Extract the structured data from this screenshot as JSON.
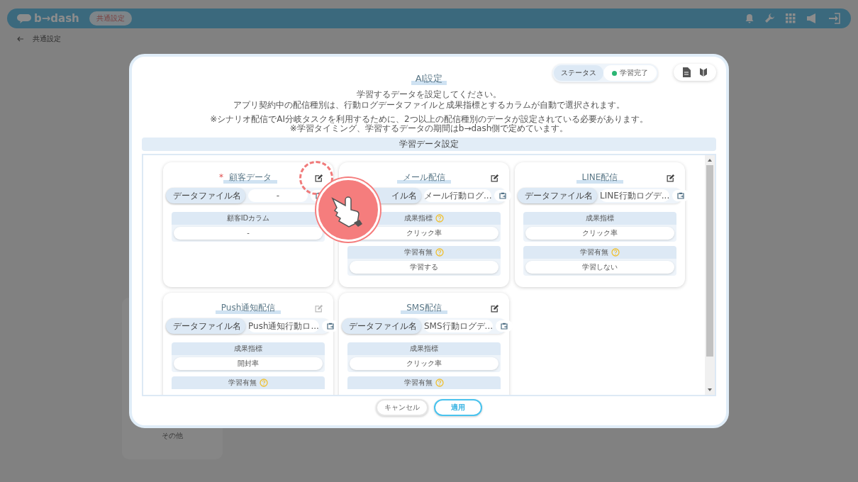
{
  "header": {
    "logo": "b→dash",
    "context_tab": "共通設定"
  },
  "breadcrumb": {
    "label": "共通設定"
  },
  "sidebar": {
    "items": [
      "その他"
    ]
  },
  "modal": {
    "title": "AI設定",
    "status": {
      "label": "ステータス",
      "value": "学習完了",
      "color": "#2bb673"
    },
    "description": [
      "学習するデータを設定してください。",
      "アプリ契約中の配信種別は、行動ログデータファイルと成果指標とするカラムが自動で選択されます。"
    ],
    "notes": [
      "※シナリオ配信でAI分岐タスクを利用するために、2つ以上の配信種別のデータが設定されている必要があります。",
      "※学習タイミング、学習するデータの期間はb→dash側で定めています。"
    ],
    "section_title": "学習データ設定",
    "cards": [
      {
        "title": "顧客データ",
        "required_mark": "*",
        "edit_disabled": false,
        "highlighted": true,
        "file_label": "データファイル名",
        "file_name": "-",
        "sections": [
          {
            "label": "顧客IDカラム",
            "help": false,
            "value": "-"
          }
        ]
      },
      {
        "title": "メール配信",
        "edit_disabled": false,
        "highlighted": false,
        "file_label": "イル名",
        "file_name": "メール行動ログ...",
        "sections": [
          {
            "label": "成果指標",
            "help": true,
            "value": "クリック率"
          },
          {
            "label": "学習有無",
            "help": true,
            "value": "学習する"
          }
        ]
      },
      {
        "title": "LINE配信",
        "edit_disabled": false,
        "highlighted": false,
        "file_label": "データファイル名",
        "file_name": "LINE行動ログデ...",
        "sections": [
          {
            "label": "成果指標",
            "help": false,
            "value": "クリック率"
          },
          {
            "label": "学習有無",
            "help": true,
            "value": "学習しない"
          }
        ]
      },
      {
        "title": "Push通知配信",
        "edit_disabled": true,
        "highlighted": false,
        "file_label": "データファイル名",
        "file_name": "Push通知行動ロ...",
        "sections": [
          {
            "label": "成果指標",
            "help": false,
            "value": "開封率"
          },
          {
            "label": "学習有無",
            "help": true
          }
        ]
      },
      {
        "title": "SMS配信",
        "edit_disabled": false,
        "highlighted": false,
        "file_label": "データファイル名",
        "file_name": "SMS行動ログデ...",
        "sections": [
          {
            "label": "成果指標",
            "help": false,
            "value": "クリック率"
          },
          {
            "label": "学習有無",
            "help": true
          }
        ]
      }
    ],
    "buttons": [
      {
        "label": "キャンセル",
        "kind": "secondary"
      },
      {
        "label": "適用",
        "kind": "primary"
      }
    ]
  }
}
